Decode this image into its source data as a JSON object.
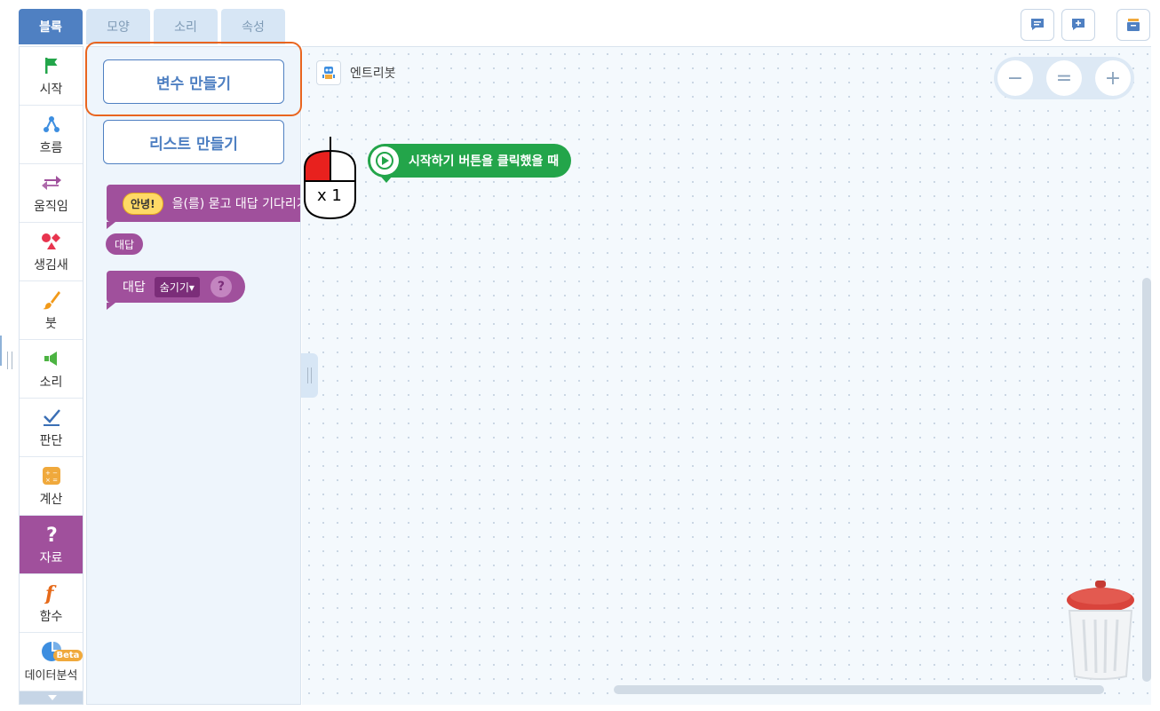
{
  "tabs": [
    "블록",
    "모양",
    "소리",
    "속성"
  ],
  "categories": [
    {
      "label": "시작",
      "icon": "flag-icon"
    },
    {
      "label": "흐름",
      "icon": "flow-icon"
    },
    {
      "label": "움직임",
      "icon": "move-arrows-icon"
    },
    {
      "label": "생김새",
      "icon": "shapes-icon"
    },
    {
      "label": "붓",
      "icon": "brush-icon"
    },
    {
      "label": "소리",
      "icon": "speaker-icon"
    },
    {
      "label": "판단",
      "icon": "check-icon"
    },
    {
      "label": "계산",
      "icon": "calculator-icon"
    },
    {
      "label": "자료",
      "icon": "question-icon",
      "active": true
    },
    {
      "label": "함수",
      "icon": "function-icon"
    },
    {
      "label": "데이터분석",
      "icon": "pie-chart-icon",
      "badge": "Beta"
    }
  ],
  "palette": {
    "make_variable": "변수 만들기",
    "make_list": "리스트 만들기",
    "ask_input": "안녕!",
    "ask_text": "을(를) 묻고 대답 기다리기",
    "answer": "대답",
    "hide_label": "대답",
    "hide_dropdown": "숨기기▾",
    "hide_help": "?"
  },
  "workspace": {
    "object_name": "엔트리봇",
    "start_block": "시작하기 버튼을 클릭했을 때",
    "zoom_out": "−",
    "zoom_reset": "=",
    "zoom_in": "+",
    "click_count": "x 1"
  },
  "colors": {
    "accent": "#4f80c2",
    "data_category": "#a0509c",
    "start_block": "#23a54a",
    "highlight": "#e9651f"
  }
}
